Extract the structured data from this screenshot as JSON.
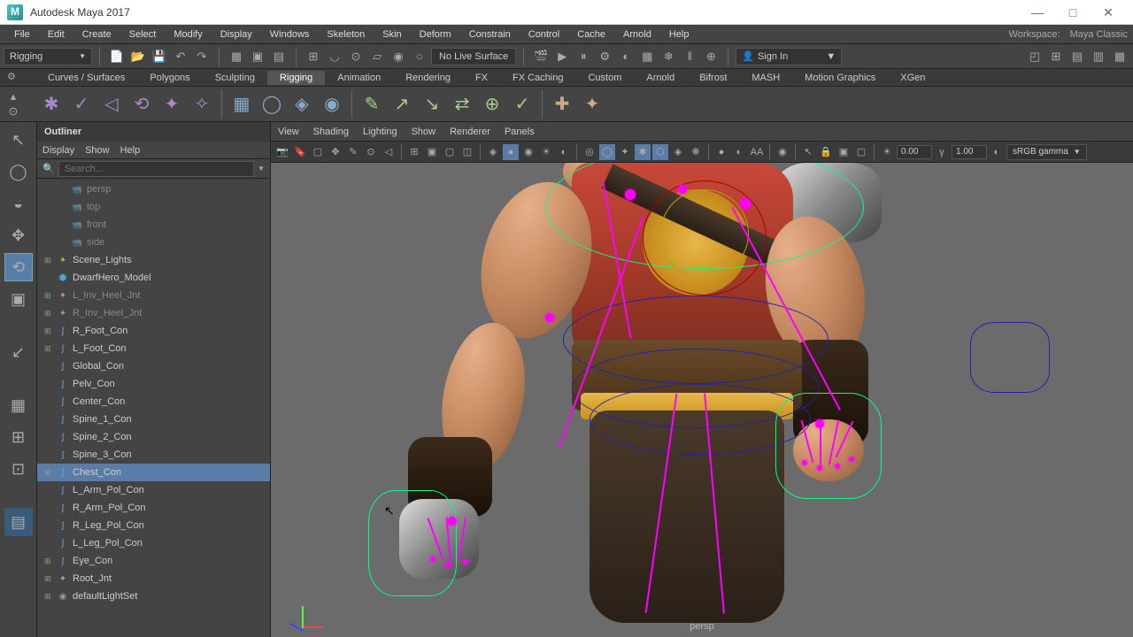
{
  "window": {
    "title": "Autodesk Maya 2017",
    "minimize": "—",
    "maximize": "□",
    "close": "✕"
  },
  "menus": [
    "File",
    "Edit",
    "Create",
    "Select",
    "Modify",
    "Display",
    "Windows",
    "Skeleton",
    "Skin",
    "Deform",
    "Constrain",
    "Control",
    "Cache",
    "Arnold",
    "Help"
  ],
  "workspace": {
    "label": "Workspace:",
    "value": "Maya Classic"
  },
  "workspace_mode": "Rigging",
  "live_surface": "No Live Surface",
  "signin": "Sign In",
  "shelf_tabs": [
    "Curves / Surfaces",
    "Polygons",
    "Sculpting",
    "Rigging",
    "Animation",
    "Rendering",
    "FX",
    "FX Caching",
    "Custom",
    "Arnold",
    "Bifrost",
    "MASH",
    "Motion Graphics",
    "XGen"
  ],
  "shelf_active_tab": 3,
  "outliner": {
    "title": "Outliner",
    "menus": [
      "Display",
      "Show",
      "Help"
    ],
    "search_placeholder": "Search...",
    "items": [
      {
        "type": "cam",
        "label": "persp",
        "dim": true,
        "indent": 0
      },
      {
        "type": "cam",
        "label": "top",
        "dim": true,
        "indent": 0
      },
      {
        "type": "cam",
        "label": "front",
        "dim": true,
        "indent": 0
      },
      {
        "type": "cam",
        "label": "side",
        "dim": true,
        "indent": 0
      },
      {
        "type": "light",
        "label": "Scene_Lights",
        "expand": true,
        "indent": 1
      },
      {
        "type": "mesh",
        "label": "DwarfHero_Model",
        "indent": 1
      },
      {
        "type": "joint",
        "label": "L_Inv_Heel_Jnt",
        "dim": true,
        "expand": true,
        "indent": 1
      },
      {
        "type": "joint",
        "label": "R_Inv_Heel_Jnt",
        "dim": true,
        "expand": true,
        "indent": 1
      },
      {
        "type": "curve",
        "label": "R_Foot_Con",
        "expand": true,
        "indent": 1
      },
      {
        "type": "curve",
        "label": "L_Foot_Con",
        "expand": true,
        "indent": 1
      },
      {
        "type": "curve",
        "label": "Global_Con",
        "indent": 1
      },
      {
        "type": "curve",
        "label": "Pelv_Con",
        "indent": 1
      },
      {
        "type": "curve",
        "label": "Center_Con",
        "indent": 1
      },
      {
        "type": "curve",
        "label": "Spine_1_Con",
        "indent": 1
      },
      {
        "type": "curve",
        "label": "Spine_2_Con",
        "indent": 1
      },
      {
        "type": "curve",
        "label": "Spine_3_Con",
        "indent": 1
      },
      {
        "type": "curve",
        "label": "Chest_Con",
        "expand": true,
        "indent": 1,
        "selected": true
      },
      {
        "type": "curve",
        "label": "L_Arm_Pol_Con",
        "indent": 1
      },
      {
        "type": "curve",
        "label": "R_Arm_Pol_Con",
        "indent": 1
      },
      {
        "type": "curve",
        "label": "R_Leg_Pol_Con",
        "indent": 1
      },
      {
        "type": "curve",
        "label": "L_Leg_Pol_Con",
        "indent": 1
      },
      {
        "type": "curve",
        "label": "Eye_Con",
        "expand": true,
        "indent": 1
      },
      {
        "type": "joint",
        "label": "Root_Jnt",
        "expand": true,
        "indent": 1
      },
      {
        "type": "default",
        "label": "defaultLightSet",
        "expand": true,
        "indent": 1
      }
    ]
  },
  "viewport": {
    "menus": [
      "View",
      "Shading",
      "Lighting",
      "Show",
      "Renderer",
      "Panels"
    ],
    "exposure": "0.00",
    "gamma": "1.00",
    "colorspace": "sRGB gamma",
    "camera_label": "persp"
  }
}
